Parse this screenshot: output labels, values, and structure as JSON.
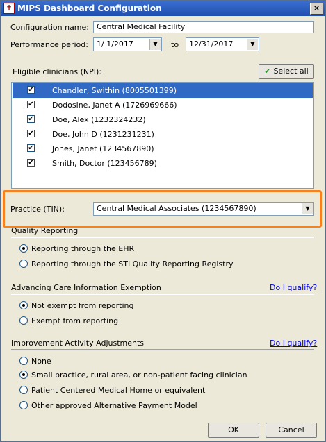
{
  "window": {
    "title": "MIPS Dashboard Configuration",
    "close_glyph": "✕"
  },
  "config_name": {
    "label": "Configuration name:",
    "value": "Central Medical Facility"
  },
  "performance_period": {
    "label": "Performance period:",
    "start": "1/  1/2017",
    "to_label": "to",
    "end": "12/31/2017"
  },
  "clinicians": {
    "label": "Eligible clinicians (NPI):",
    "select_all_label": "Select all",
    "items": [
      {
        "name": "Chandler, Swithin (8005501399)",
        "checked": true,
        "selected": true
      },
      {
        "name": "Dodosine, Janet A (1726969666)",
        "checked": true,
        "selected": false
      },
      {
        "name": "Doe, Alex  (1232324232)",
        "checked": true,
        "selected": false
      },
      {
        "name": "Doe, John D (1231231231)",
        "checked": true,
        "selected": false
      },
      {
        "name": "Jones, Janet (1234567890)",
        "checked": true,
        "selected": false
      },
      {
        "name": "Smith, Doctor (123456789)",
        "checked": true,
        "selected": false
      }
    ]
  },
  "practice": {
    "label": "Practice (TIN):",
    "value": "Central Medical Associates (1234567890)"
  },
  "quality_reporting": {
    "title": "Quality Reporting",
    "options": [
      {
        "label": "Reporting through the EHR",
        "selected": true
      },
      {
        "label": "Reporting through the STI Quality Reporting Registry",
        "selected": false
      }
    ]
  },
  "aci_exemption": {
    "title": "Advancing Care Information Exemption",
    "link": "Do I qualify?",
    "options": [
      {
        "label": "Not exempt from reporting",
        "selected": true
      },
      {
        "label": "Exempt from reporting",
        "selected": false
      }
    ]
  },
  "improvement_activity": {
    "title": "Improvement Activity Adjustments",
    "link": "Do I qualify?",
    "options": [
      {
        "label": "None",
        "selected": false
      },
      {
        "label": "Small practice, rural area, or non-patient facing clinician",
        "selected": true
      },
      {
        "label": "Patient Centered Medical Home or equivalent",
        "selected": false
      },
      {
        "label": "Other approved Alternative Payment Model",
        "selected": false
      }
    ]
  },
  "buttons": {
    "ok": "OK",
    "cancel": "Cancel"
  },
  "colors": {
    "highlight": "#f58220",
    "selection": "#316ac5",
    "link": "#0000ee"
  }
}
